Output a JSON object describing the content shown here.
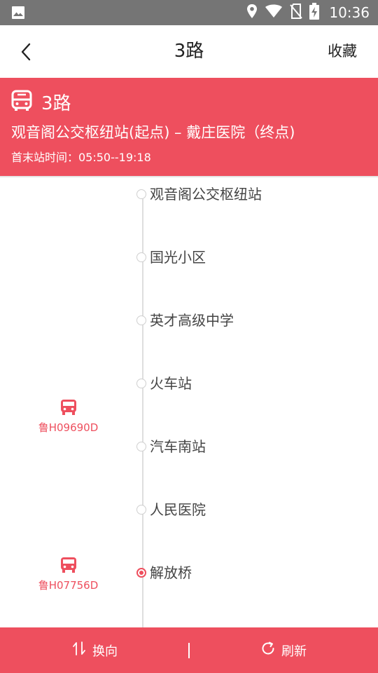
{
  "status_bar": {
    "time": "10:36",
    "icons": [
      "image-icon",
      "location-icon",
      "wifi-icon",
      "no-sim-icon",
      "battery-charging-icon"
    ]
  },
  "header": {
    "title": "3路",
    "favorite_label": "收藏"
  },
  "route": {
    "name": "3路",
    "direction": "观音阁公交枢纽站(起点) – 戴庄医院（终点)",
    "hours": "首末站时间：05:50--19:18"
  },
  "stops": [
    {
      "name": "观音阁公交枢纽站",
      "current": false
    },
    {
      "name": "国光小区",
      "current": false
    },
    {
      "name": "英才高级中学",
      "current": false
    },
    {
      "name": "火车站",
      "current": false
    },
    {
      "name": "汽车南站",
      "current": false
    },
    {
      "name": "人民医院",
      "current": false
    },
    {
      "name": "解放桥",
      "current": true
    }
  ],
  "vehicles": [
    {
      "plate": "鲁H09690D"
    },
    {
      "plate": "鲁H07756D"
    }
  ],
  "bottom_bar": {
    "switch_label": "换向",
    "refresh_label": "刷新"
  },
  "colors": {
    "accent": "#ee4f5e",
    "status_bar": "#757575"
  }
}
